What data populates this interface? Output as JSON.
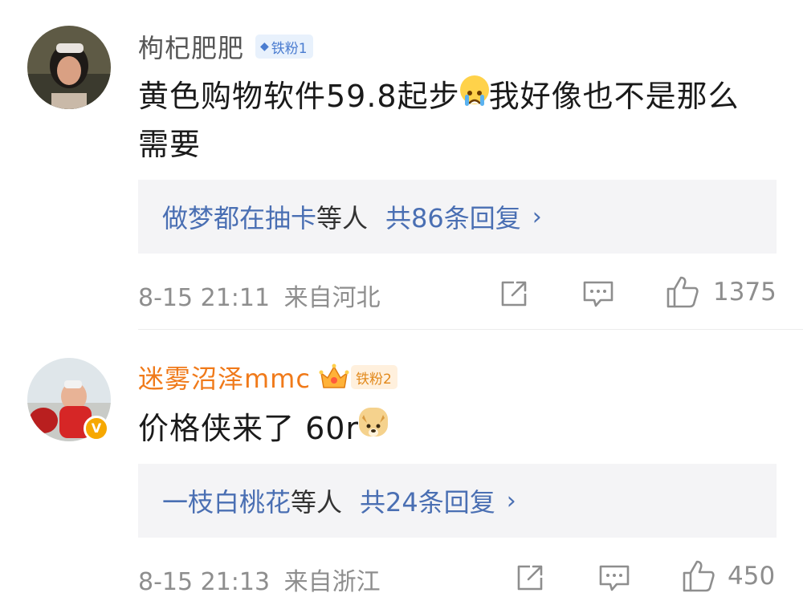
{
  "comments": [
    {
      "username": "枸杞肥肥",
      "fan_badge": "铁粉1",
      "text": "黄色购物软件59.8起步😭我好像也不是那么需要",
      "text_line1_a": "黄色购物软件59.8起步",
      "text_line1_b": "我好像也不是那么",
      "text_line2": "需要",
      "reply_names": "做梦都在抽卡",
      "reply_deng": "等人",
      "reply_count": "共86条回复",
      "reply_chevron": "›",
      "date": "8-15 21:11",
      "location": "来自河北",
      "likes": "1375",
      "icons": [
        "share-icon",
        "comment-icon",
        "like-icon"
      ]
    },
    {
      "username": "迷雾沼泽mmc",
      "fan_badge": "铁粉2",
      "verified_badge": "V",
      "text": "价格侠来了 60r",
      "text_line1_a": "价格侠来了 60r",
      "reply_names": "一枝白桃花",
      "reply_deng": "等人",
      "reply_count": "共24条回复",
      "reply_chevron": "›",
      "date": "8-15 21:13",
      "location": "来自浙江",
      "likes": "450",
      "icons": [
        "share-icon",
        "comment-icon",
        "like-icon"
      ]
    }
  ],
  "colors": {
    "link_blue": "#4a6fb3",
    "username_orange": "#f07a1a",
    "meta_gray": "#8e8e8e",
    "reply_bg": "#f4f4f6"
  }
}
